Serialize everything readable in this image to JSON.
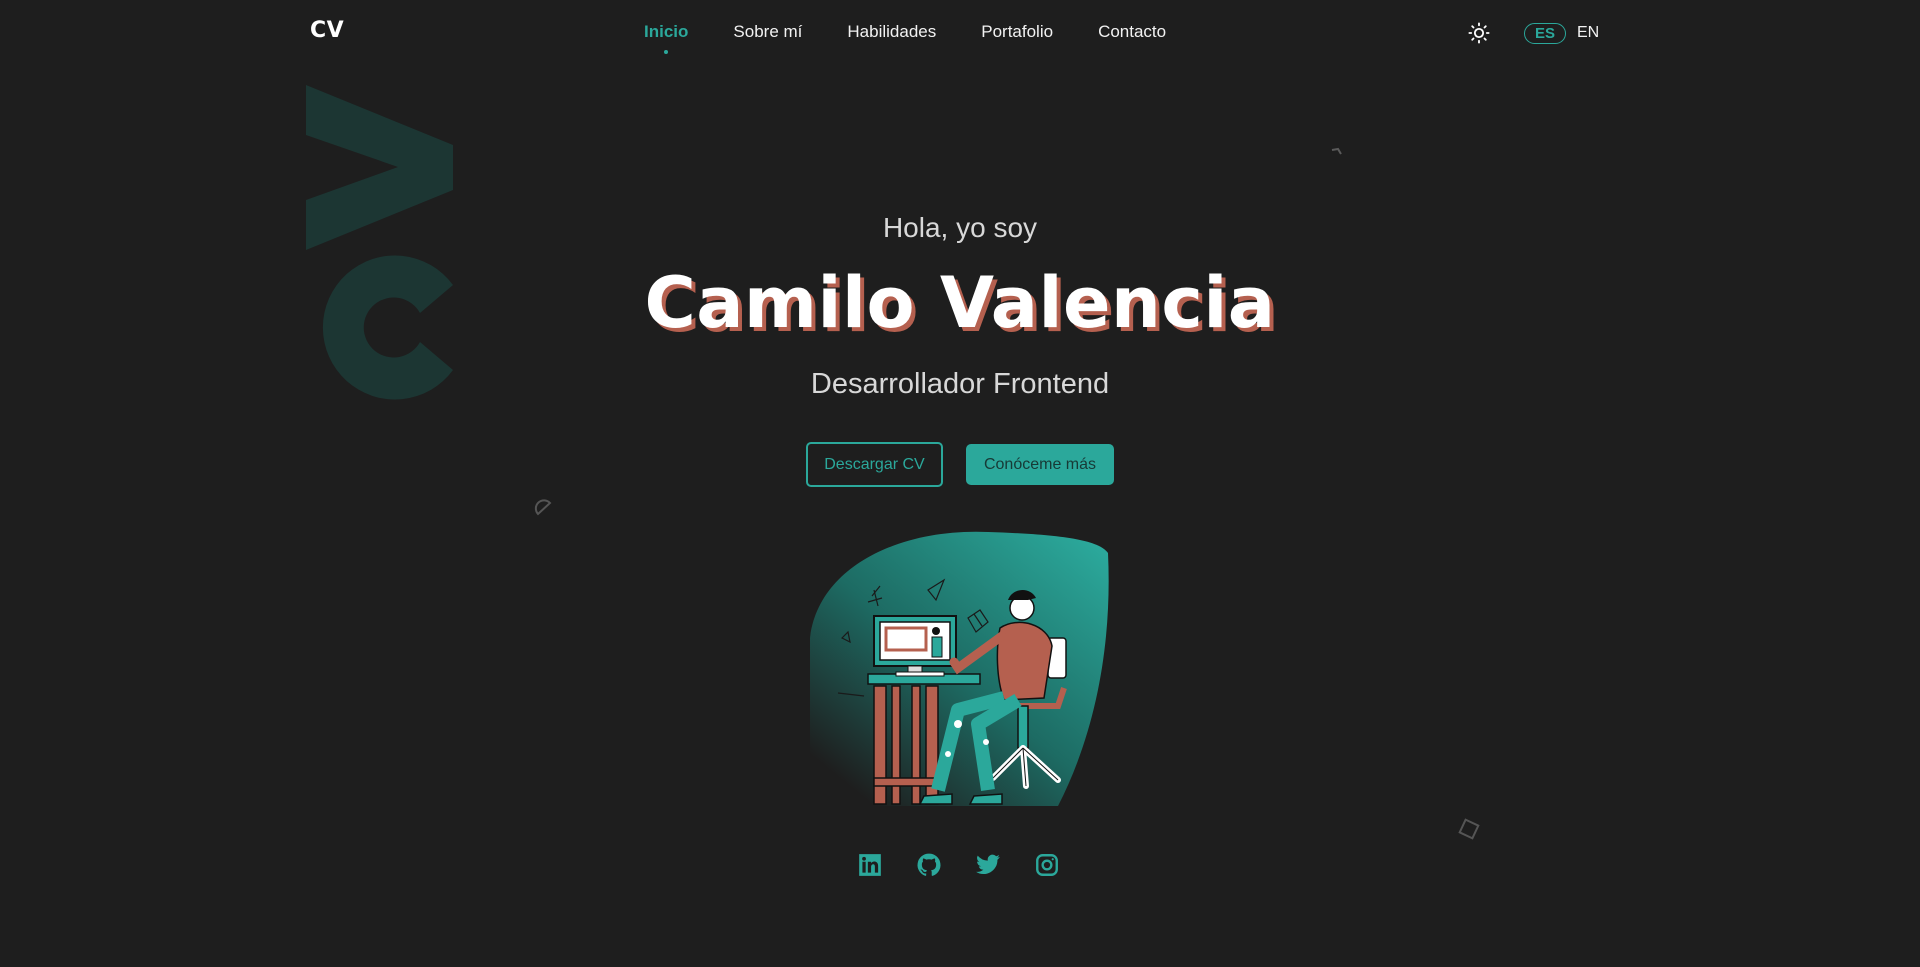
{
  "nav": {
    "logo": "CV",
    "links": [
      {
        "label": "Inicio",
        "active": true
      },
      {
        "label": "Sobre mí",
        "active": false
      },
      {
        "label": "Habilidades",
        "active": false
      },
      {
        "label": "Portafolio",
        "active": false
      },
      {
        "label": "Contacto",
        "active": false
      }
    ],
    "theme_icon": "sun-icon",
    "languages": {
      "selected": "ES",
      "other": "EN"
    }
  },
  "hero": {
    "greeting": "Hola, yo soy",
    "name": "Camilo Valencia",
    "role": "Desarrollador Frontend",
    "buttons": {
      "download": "Descargar CV",
      "more": "Conóceme más"
    }
  },
  "social": [
    "linkedin-icon",
    "github-icon",
    "twitter-icon",
    "instagram-icon"
  ],
  "colors": {
    "background": "#1e1e1e",
    "accent": "#2ba89b",
    "name_shadow": "#b5604f",
    "text": "#f2f2f2"
  }
}
